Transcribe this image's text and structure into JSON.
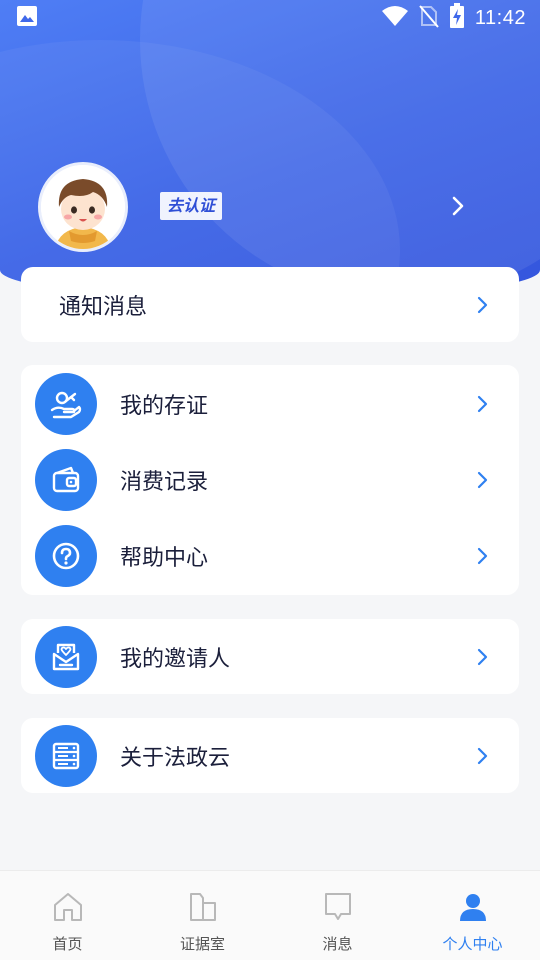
{
  "status_bar": {
    "time": "11:42",
    "icons": [
      "image-icon",
      "wifi-icon",
      "no-sim-icon",
      "battery-charging-icon"
    ]
  },
  "profile": {
    "verify_label": "去认证"
  },
  "notice": {
    "label": "通知消息"
  },
  "menu_group_1": [
    {
      "label": "我的存证",
      "icon": "certificate-hand-icon"
    },
    {
      "label": "消费记录",
      "icon": "wallet-icon"
    },
    {
      "label": "帮助中心",
      "icon": "help-circle-icon"
    }
  ],
  "menu_group_2": [
    {
      "label": "我的邀请人",
      "icon": "invite-envelope-icon"
    }
  ],
  "menu_group_3": [
    {
      "label": "关于法政云",
      "icon": "server-list-icon"
    }
  ],
  "bottom_nav": [
    {
      "label": "首页",
      "icon": "home-icon",
      "active": false
    },
    {
      "label": "证据室",
      "icon": "folder-icon",
      "active": false
    },
    {
      "label": "消息",
      "icon": "message-icon",
      "active": false
    },
    {
      "label": "个人中心",
      "icon": "person-icon",
      "active": true
    }
  ],
  "colors": {
    "accent": "#2f80f0",
    "header_gradient_start": "#4f7ef5",
    "header_gradient_end": "#3455dd",
    "text_primary": "#1b1f3b"
  }
}
